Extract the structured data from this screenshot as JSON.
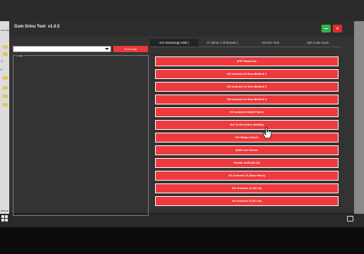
{
  "app": {
    "title": "Gsm Srinu Tool  v1.0.5",
    "close_symbol": "×",
    "accent_red": "#ee3a3d",
    "min_green": "#33b24a"
  },
  "left_panel": {
    "port_select_value": "",
    "port_scan_label": "Port Scan",
    "log_label": "Logs"
  },
  "tabs": [
    {
      "label": "KG Samsung( ADB )",
      "active": true
    },
    {
      "label": "IT Admin ( All Brands )",
      "active": false
    },
    {
      "label": "Service Tool",
      "active": false
    },
    {
      "label": "QR Code Scan",
      "active": false
    }
  ],
  "actions": [
    "MTP Read Info",
    "KG Android 14 New Method 1",
    "KG Android 14 New Method 2",
    "KG Android 14 New Method 3",
    "KG Android 14(All Patch)",
    "Set To KG Active (KNMS)",
    "KG Status Check",
    "ADB Live Screen",
    "Enable ADB (85-23)",
    "KG Android 13 (New Patch)",
    "KG Android 13 (23-24)",
    "KG Android 12 (07-23)"
  ],
  "desktop": {
    "left_fragments": [
      "chrome",
      "O",
      "E",
      "eleme"
    ]
  },
  "icons": {
    "minimize": "minimize-icon",
    "close": "close-icon",
    "dropdown": "chevron-down-icon",
    "cursor": "hand-cursor-icon",
    "start": "windows-start-icon",
    "notifications": "notification-icon"
  }
}
